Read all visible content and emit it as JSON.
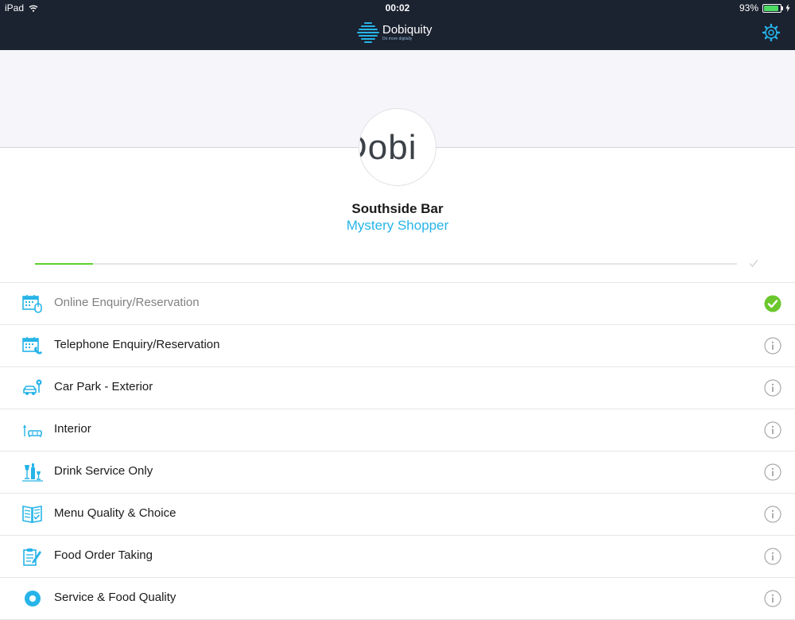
{
  "status_bar": {
    "device": "iPad",
    "time": "00:02",
    "battery": "93%"
  },
  "nav": {
    "brand_name": "Dobiquity",
    "brand_tagline": "Do more digitally"
  },
  "profile": {
    "logo_text": "Dobi",
    "venue": "Southside Bar",
    "survey": "Mystery Shopper"
  },
  "progress": {
    "fraction": 0.083
  },
  "colors": {
    "accent": "#27b4e8",
    "complete": "#6bc72e",
    "progress": "#5cd12c",
    "navbar": "#1b2230"
  },
  "sections": [
    {
      "label": "Online Enquiry/Reservation",
      "icon": "calendar-mouse-icon",
      "status": "complete"
    },
    {
      "label": "Telephone Enquiry/Reservation",
      "icon": "calendar-phone-icon",
      "status": "info"
    },
    {
      "label": "Car Park - Exterior",
      "icon": "car-pin-icon",
      "status": "info"
    },
    {
      "label": "Interior",
      "icon": "sofa-lamp-icon",
      "status": "info"
    },
    {
      "label": "Drink Service Only",
      "icon": "bottle-glasses-icon",
      "status": "info"
    },
    {
      "label": "Menu Quality & Choice",
      "icon": "menu-book-icon",
      "status": "info"
    },
    {
      "label": "Food Order Taking",
      "icon": "order-pad-icon",
      "status": "info"
    },
    {
      "label": "Service & Food Quality",
      "icon": "service-badge-icon",
      "status": "info"
    }
  ]
}
